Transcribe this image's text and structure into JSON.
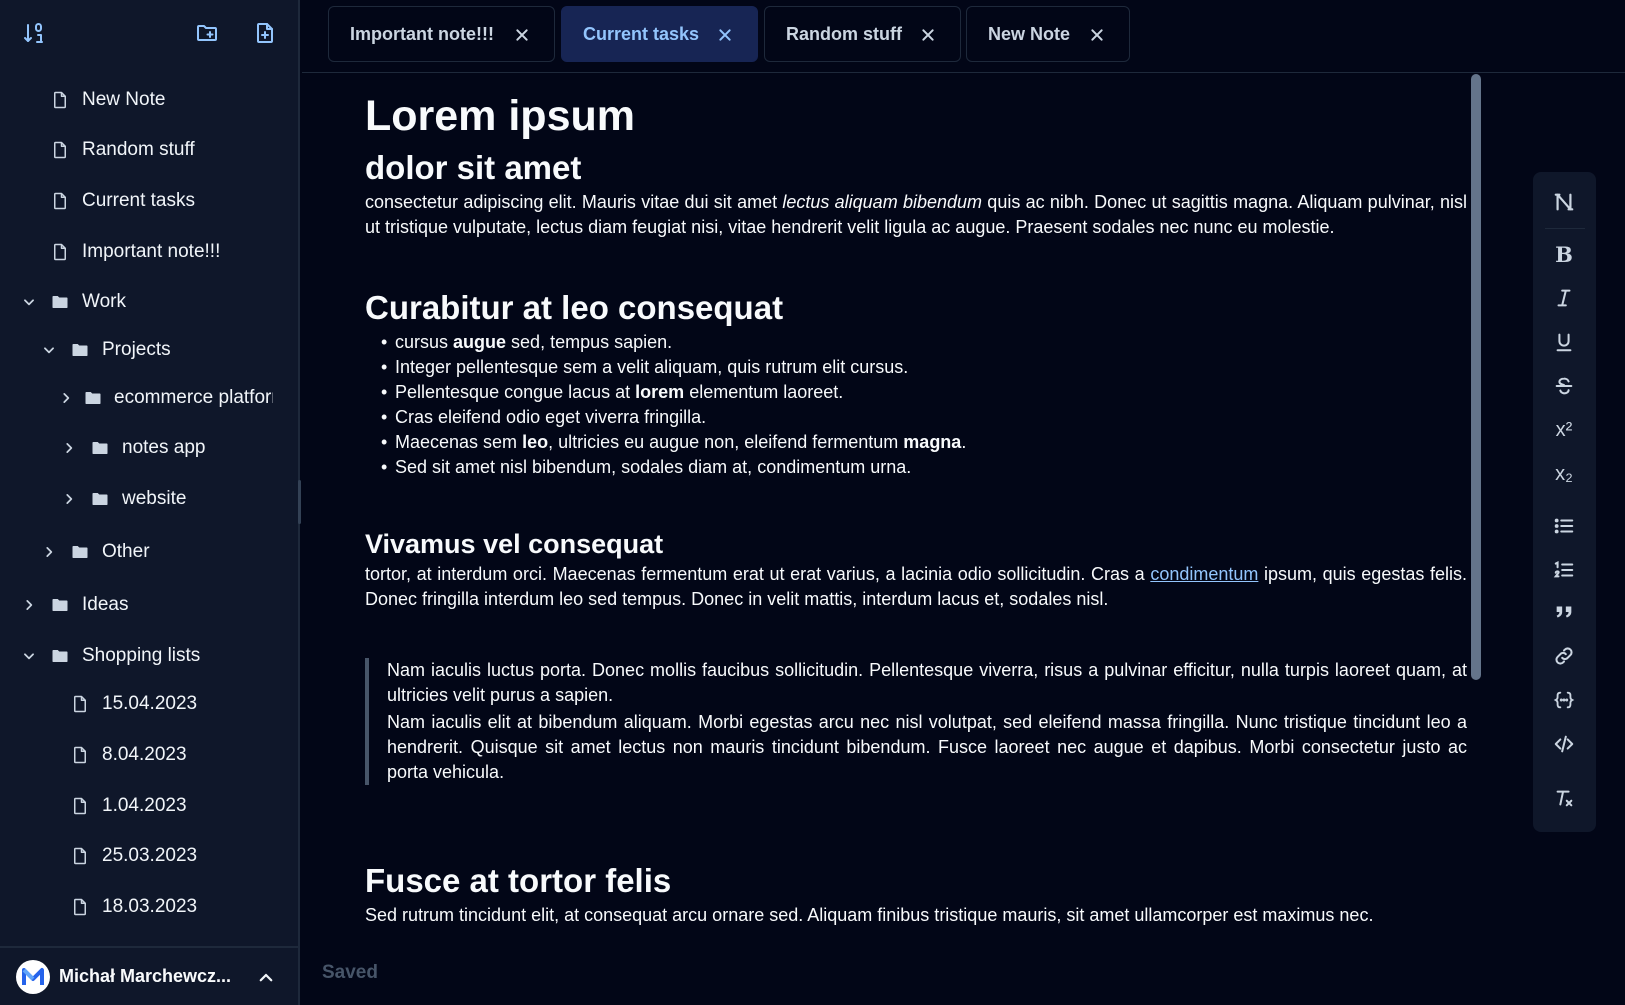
{
  "sidebar": {
    "toolbar": {
      "sort_icon": "sort-icon",
      "new_folder_icon": "new-folder-icon",
      "new_note_icon": "new-note-icon"
    },
    "items": [
      {
        "label": "New Note",
        "kind": "note"
      },
      {
        "label": "Random stuff",
        "kind": "note"
      },
      {
        "label": "Current tasks",
        "kind": "note"
      },
      {
        "label": "Important note!!!",
        "kind": "note"
      },
      {
        "label": "Work",
        "kind": "folder",
        "expanded": true
      },
      {
        "label": "Projects",
        "kind": "folder",
        "expanded": true
      },
      {
        "label": "ecommerce platform",
        "kind": "folder",
        "expanded": false
      },
      {
        "label": "notes app",
        "kind": "folder",
        "expanded": false
      },
      {
        "label": "website",
        "kind": "folder",
        "expanded": false
      },
      {
        "label": "Other",
        "kind": "folder",
        "expanded": false
      },
      {
        "label": "Ideas",
        "kind": "folder",
        "expanded": false
      },
      {
        "label": "Shopping lists",
        "kind": "folder",
        "expanded": true
      },
      {
        "label": "15.04.2023",
        "kind": "note"
      },
      {
        "label": "8.04.2023",
        "kind": "note"
      },
      {
        "label": "1.04.2023",
        "kind": "note"
      },
      {
        "label": "25.03.2023",
        "kind": "note"
      },
      {
        "label": "18.03.2023",
        "kind": "note"
      }
    ],
    "user": {
      "name": "Michał Marchewcz..."
    }
  },
  "tabs": [
    {
      "label": "Important note!!!",
      "active": false
    },
    {
      "label": "Current tasks",
      "active": true
    },
    {
      "label": "Random stuff",
      "active": false
    },
    {
      "label": "New Note",
      "active": false
    }
  ],
  "status": {
    "saved": "Saved"
  },
  "doc": {
    "title": "Lorem ipsum",
    "subtitle": "dolor sit amet",
    "p1": {
      "a": "consectetur adipiscing elit. Mauris vitae dui sit amet ",
      "em": "lectus aliquam bibendum",
      "b": " quis ac nibh. Donec ut sagittis magna. Aliquam pulvinar, nisl ut tristique vulputate, lectus diam feugiat nisi, vitae hendrerit velit ligula ac augue. Praesent sodales nec nunc eu molestie."
    },
    "h2": "Curabitur at leo consequat",
    "bullets": {
      "b1": {
        "a": "cursus ",
        "strong": "augue",
        "b": " sed, tempus sapien."
      },
      "b2": "Integer pellentesque sem a velit aliquam, quis rutrum elit cursus.",
      "b3": {
        "a": "Pellentesque congue lacus at ",
        "strong": "lorem",
        "b": " elementum laoreet."
      },
      "b4": "Cras eleifend odio eget viverra fringilla.",
      "b5": {
        "a": "Maecenas sem ",
        "strong1": "leo",
        "b": ", ultricies eu augue non, eleifend fermentum ",
        "strong2": "magna",
        "c": "."
      },
      "b6": "Sed sit amet nisl bibendum, sodales diam at, condimentum urna."
    },
    "h3": "Vivamus vel consequat",
    "p2": {
      "a": "tortor, at interdum orci. Maecenas fermentum erat ut erat varius, a lacinia odio sollicitudin. Cras a ",
      "link": "condimentum",
      "b": " ipsum, quis egestas felis. Donec fringilla interdum leo sed tempus. Donec in velit mattis, interdum lacus et, sodales nisl."
    },
    "quote1": "Nam iaculis luctus porta. Donec mollis faucibus sollicitudin. Pellentesque viverra, risus a pulvinar efficitur, nulla turpis laoreet quam, at ultricies velit purus a sapien.",
    "quote2": "Nam iaculis elit at bibendum aliquam. Morbi egestas arcu nec nisl volutpat, sed eleifend massa fringilla. Nunc tristique tincidunt leo a hendrerit. Quisque sit amet lectus non mauris tincidunt bibendum. Fusce laoreet nec augue et dapibus. Morbi consectetur justo ac porta vehicula.",
    "h2b": "Fusce at tortor felis",
    "p3": "Sed rutrum tincidunt elit, at consequat arcu ornare sed. Aliquam finibus tristique mauris, sit amet ullamcorper est maximus nec."
  },
  "format_toolbar": {
    "bold": "B",
    "superscript": "x²",
    "subscript": "x₂",
    "icons": [
      "heading-icon",
      "bold-icon",
      "italic-icon",
      "underline-icon",
      "strikethrough-icon",
      "superscript-icon",
      "subscript-icon",
      "bullet-list-icon",
      "numbered-list-icon",
      "quote-icon",
      "link-icon",
      "code-block-icon",
      "inline-code-icon",
      "clear-format-icon"
    ]
  },
  "colors": {
    "background": "#020617",
    "sidebar": "#0f172a",
    "accent": "#93c5fd",
    "active_tab": "#172554"
  }
}
